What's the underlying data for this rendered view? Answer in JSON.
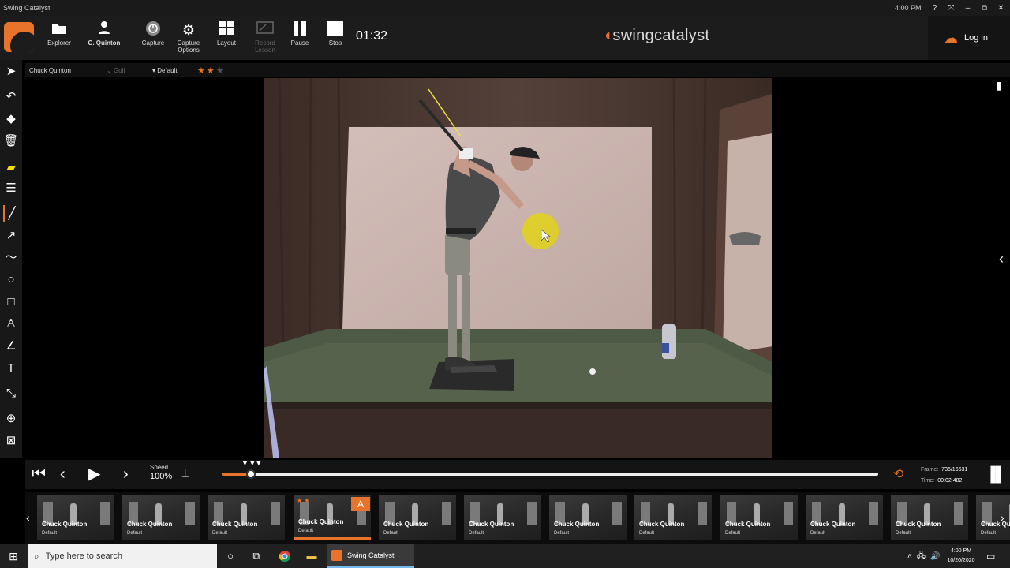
{
  "window": {
    "title": "Swing Catalyst",
    "time": "4:00 PM",
    "controls": [
      "?",
      "⤧",
      "–",
      "⧉",
      "✕"
    ]
  },
  "toolbar": {
    "buttons": [
      {
        "label": "Explorer",
        "icon": "folder-icon"
      },
      {
        "label": "C. Quinton",
        "icon": "person-icon"
      },
      {
        "label": "Capture",
        "icon": "power-icon"
      },
      {
        "label": "Capture Options",
        "icon": "gear-icon"
      },
      {
        "label": "Layout",
        "icon": "grid-icon"
      },
      {
        "label": "Record Lesson",
        "icon": "record-lesson-icon"
      },
      {
        "label": "Pause",
        "icon": "pause-icon"
      },
      {
        "label": "Stop",
        "icon": "stop-icon"
      }
    ],
    "timer": "01:32",
    "brand": "swingcatalyst",
    "login": "Log in"
  },
  "info": {
    "player": "Chuck Quinton",
    "sport": "Golf",
    "category": "Default",
    "rating": 2,
    "rating_max": 3
  },
  "playback": {
    "speed_label": "Speed",
    "speed_value": "100%",
    "progress": 0.044,
    "frame_label": "Frame:",
    "frame_value": "736/16631",
    "time_label": "Time:",
    "time_value": "00:02:482"
  },
  "thumbnails": [
    {
      "name": "Chuck Quinton",
      "sub": "Default"
    },
    {
      "name": "Chuck Quinton",
      "sub": "Default"
    },
    {
      "name": "Chuck Quinton",
      "sub": "Default"
    },
    {
      "name": "Chuck Quinton",
      "sub": "Default",
      "stars": "★ ★",
      "badge": "A",
      "active": true
    },
    {
      "name": "Chuck Quinton",
      "sub": "Default"
    },
    {
      "name": "Chuck Quinton",
      "sub": "Default"
    },
    {
      "name": "Chuck Quinton",
      "sub": "Default"
    },
    {
      "name": "Chuck Quinton",
      "sub": "Default"
    },
    {
      "name": "Chuck Quinton",
      "sub": "Default"
    },
    {
      "name": "Chuck Quinton",
      "sub": "Default"
    },
    {
      "name": "Chuck Quinton",
      "sub": "Default"
    },
    {
      "name": "Chuck Qu",
      "sub": "Default"
    }
  ],
  "taskbar": {
    "search_placeholder": "Type here to search",
    "app_label": "Swing Catalyst",
    "clock_time": "4:00 PM",
    "clock_date": "10/20/2020"
  },
  "colors": {
    "accent": "#e8732a",
    "toolbar": "#1c1c1c",
    "annotation_line": "#f0e040",
    "annotation_dot": "#e0d020"
  }
}
